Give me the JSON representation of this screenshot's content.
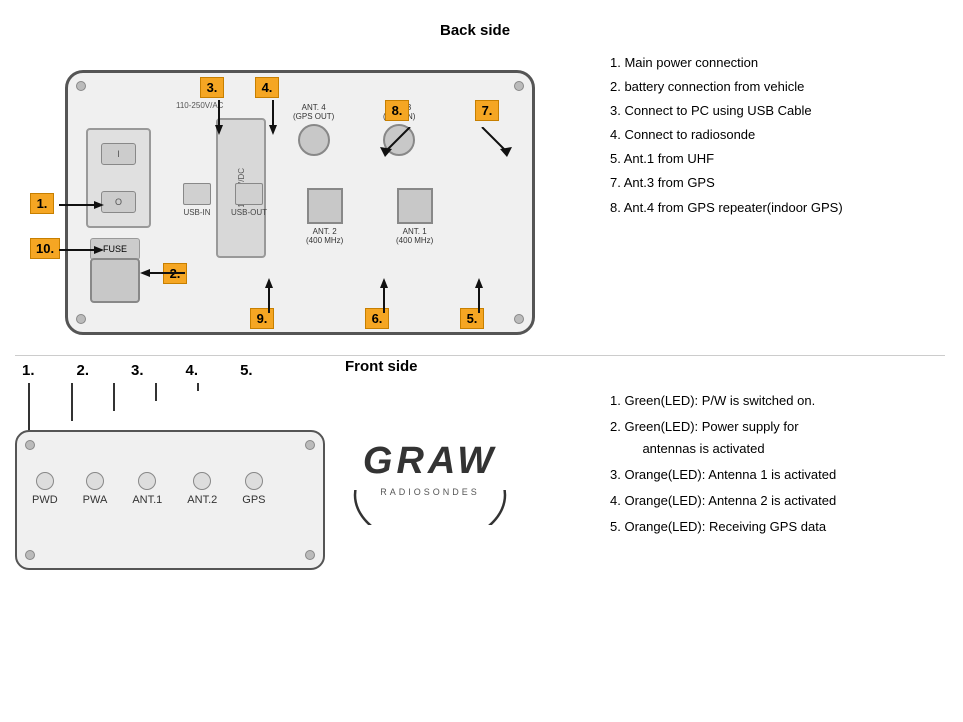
{
  "backSide": {
    "title": "Back side",
    "description": [
      {
        "num": "1.",
        "text": "Main power connection"
      },
      {
        "num": "2.",
        "text": "battery connection from vehicle"
      },
      {
        "num": "3.",
        "text": "Connect to PC using USB Cable"
      },
      {
        "num": "4.",
        "text": "Connect to radiosonde"
      },
      {
        "num": "5.",
        "text": "Ant.1 from UHF"
      },
      {
        "num": "7.",
        "text": "Ant.3 from GPS"
      },
      {
        "num": "8.",
        "text": "Ant.4 from GPS repeater(indoor GPS)"
      }
    ],
    "labels": {
      "1": "1.",
      "2": "2.",
      "3": "3.",
      "4": "4.",
      "5": "5.",
      "6": "6.",
      "7": "7.",
      "8": "8.",
      "9": "9.",
      "10": "10."
    },
    "internals": {
      "voltageLabel": "110-250V/AC",
      "dcLabel": "10-32V/DC",
      "usbIn": "USB-IN",
      "usbOut": "USB-OUT",
      "ant4Label": "ANT. 4\n(GPS OUT)",
      "ant3Label": "ANT. 3\n(GPS IN)",
      "ant2Label": "ANT. 2\n(400 MHz)",
      "ant1Label": "ANT. 1\n(400 MHz)",
      "fuseLabel": "FUSE",
      "switchI": "I",
      "switchO": "O"
    }
  },
  "frontSide": {
    "title": "Front side",
    "ledLabels": [
      "PWD",
      "PWA",
      "ANT.1",
      "ANT.2",
      "GPS"
    ],
    "numLabels": [
      "1.",
      "2.",
      "3.",
      "4.",
      "5."
    ],
    "description": [
      {
        "num": "1.",
        "text": "Green(LED): P/W is switched on."
      },
      {
        "num": "2.",
        "text": "Green(LED): Power supply for antennas is activated"
      },
      {
        "num": "3.",
        "text": "Orange(LED): Antenna 1 is activated"
      },
      {
        "num": "4.",
        "text": "Orange(LED): Antenna 2 is activated"
      },
      {
        "num": "5.",
        "text": "Orange(LED): Receiving GPS data"
      }
    ]
  },
  "graw": {
    "brand": "GRAW",
    "sub": "RADIOSONDES"
  }
}
